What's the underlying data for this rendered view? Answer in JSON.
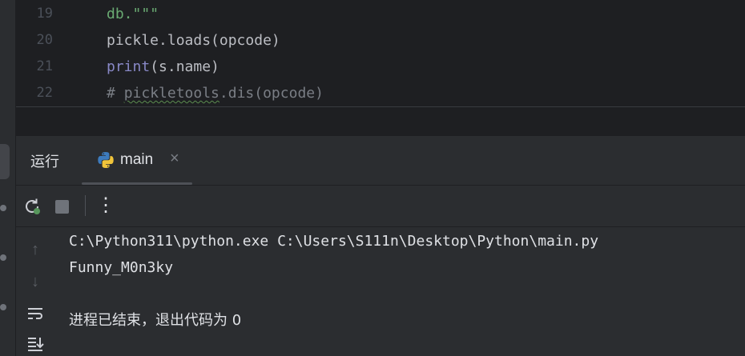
{
  "editor": {
    "lines": [
      {
        "number": "19",
        "parts": [
          {
            "text": "db.",
            "kind": "string"
          },
          {
            "text": "\"\"\"",
            "kind": "string"
          }
        ]
      },
      {
        "number": "20",
        "parts": [
          {
            "text": "pickle.loads(opcode)",
            "kind": "plain"
          }
        ]
      },
      {
        "number": "21",
        "parts": [
          {
            "text": "print",
            "kind": "builtin"
          },
          {
            "text": "(s.name)",
            "kind": "plain"
          }
        ]
      },
      {
        "number": "22",
        "parts": [
          {
            "text": "# ",
            "kind": "comment"
          },
          {
            "text": "pickletools",
            "kind": "comment-typo"
          },
          {
            "text": ".dis(opcode)",
            "kind": "comment"
          }
        ]
      }
    ]
  },
  "tool_window": {
    "title": "运行",
    "tab_label": "main",
    "tab_close_glyph": "×"
  },
  "toolbar": {
    "rerun_icon": "rerun-icon",
    "stop_icon": "stop-icon",
    "more_glyph": "⋮"
  },
  "console": {
    "lines": [
      "C:\\Python311\\python.exe C:\\Users\\S111n\\Desktop\\Python\\main.py",
      "Funny_M0n3ky",
      "",
      "进程已结束，退出代码为 0"
    ]
  },
  "colors": {
    "string": "#6aab73",
    "builtin": "#8888c6",
    "comment": "#7a7e85",
    "text": "#bcbec4"
  }
}
